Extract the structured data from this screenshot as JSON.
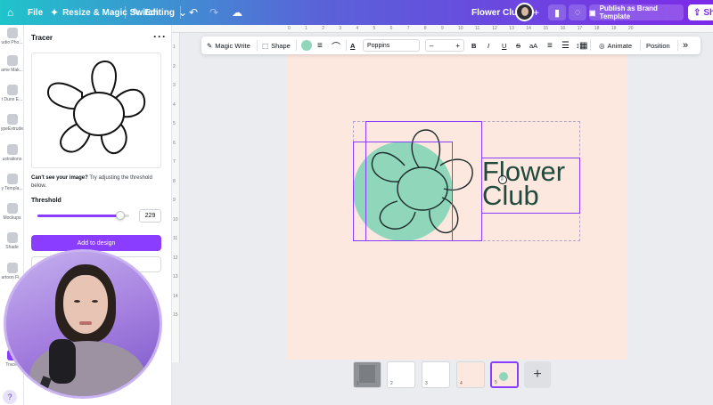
{
  "topbar": {
    "home_icon": "home-icon",
    "file_label": "File",
    "resize_label": "Resize & Magic Switch",
    "editing_label": "Editing",
    "undo_icon": "undo-icon",
    "redo_icon": "redo-icon",
    "cloud_icon": "cloud-save-icon",
    "doc_title": "Flower Club",
    "add_icon": "plus-icon",
    "chart_icon": "analytics-icon",
    "comment_icon": "comment-icon",
    "publish_label": "Publish as Brand Template",
    "share_label": "Sha"
  },
  "rail": {
    "items": [
      {
        "label": "udio Pho...",
        "icon": "studio-photo-icon"
      },
      {
        "label": "ame Mak...",
        "icon": "frame-maker-icon"
      },
      {
        "label": "t Dunn E...",
        "icon": "app-icon"
      },
      {
        "label": "ypeExtrude",
        "icon": "type-extrude-icon"
      },
      {
        "label": "ustrations",
        "icon": "illustrations-icon"
      },
      {
        "label": "y Templa...",
        "icon": "templates-icon"
      },
      {
        "label": "Mockups",
        "icon": "mockups-icon"
      },
      {
        "label": "Shade",
        "icon": "shade-icon"
      },
      {
        "label": "artoon Fi...",
        "icon": "cartoon-icon"
      },
      {
        "label": "P",
        "icon": "app-icon"
      },
      {
        "label": "Tracer",
        "icon": "tracer-icon"
      }
    ]
  },
  "panel": {
    "title": "Tracer",
    "more_icon": "more-horizontal-icon",
    "hint_bold": "Can't see your image?",
    "hint_rest": " Try adjusting the threshold below.",
    "threshold_label": "Threshold",
    "threshold_value": "229",
    "threshold_fraction": 0.9,
    "add_button": "Add to design"
  },
  "ruler": {
    "top": [
      "0",
      "1",
      "2",
      "3",
      "4",
      "5",
      "6",
      "7",
      "8",
      "9",
      "10",
      "11",
      "12",
      "13",
      "14",
      "15",
      "16",
      "17",
      "18",
      "19",
      "20"
    ],
    "left": [
      "1",
      "2",
      "3",
      "4",
      "5",
      "6",
      "7",
      "8",
      "9",
      "10",
      "11",
      "12",
      "13",
      "14",
      "15"
    ]
  },
  "toolbar": {
    "magic_write": "Magic Write",
    "shape": "Shape",
    "fill_color": "#8fd6ba",
    "font": "Poppins",
    "font_size_minus": "–",
    "font_size_plus": "+",
    "bold": "B",
    "italic": "I",
    "underline": "U",
    "strike": "S",
    "case": "aA",
    "animate": "Animate",
    "position": "Position",
    "more": "»"
  },
  "design": {
    "title_line1": "Flower",
    "title_line2": "Club",
    "text_color": "#214a3d",
    "circle_color": "#8fd6ba",
    "page_bg": "#fce8df"
  },
  "pages": {
    "thumbs": [
      "1",
      "2",
      "3",
      "4",
      "5"
    ],
    "active": "5",
    "add_label": "+"
  },
  "help": "?"
}
